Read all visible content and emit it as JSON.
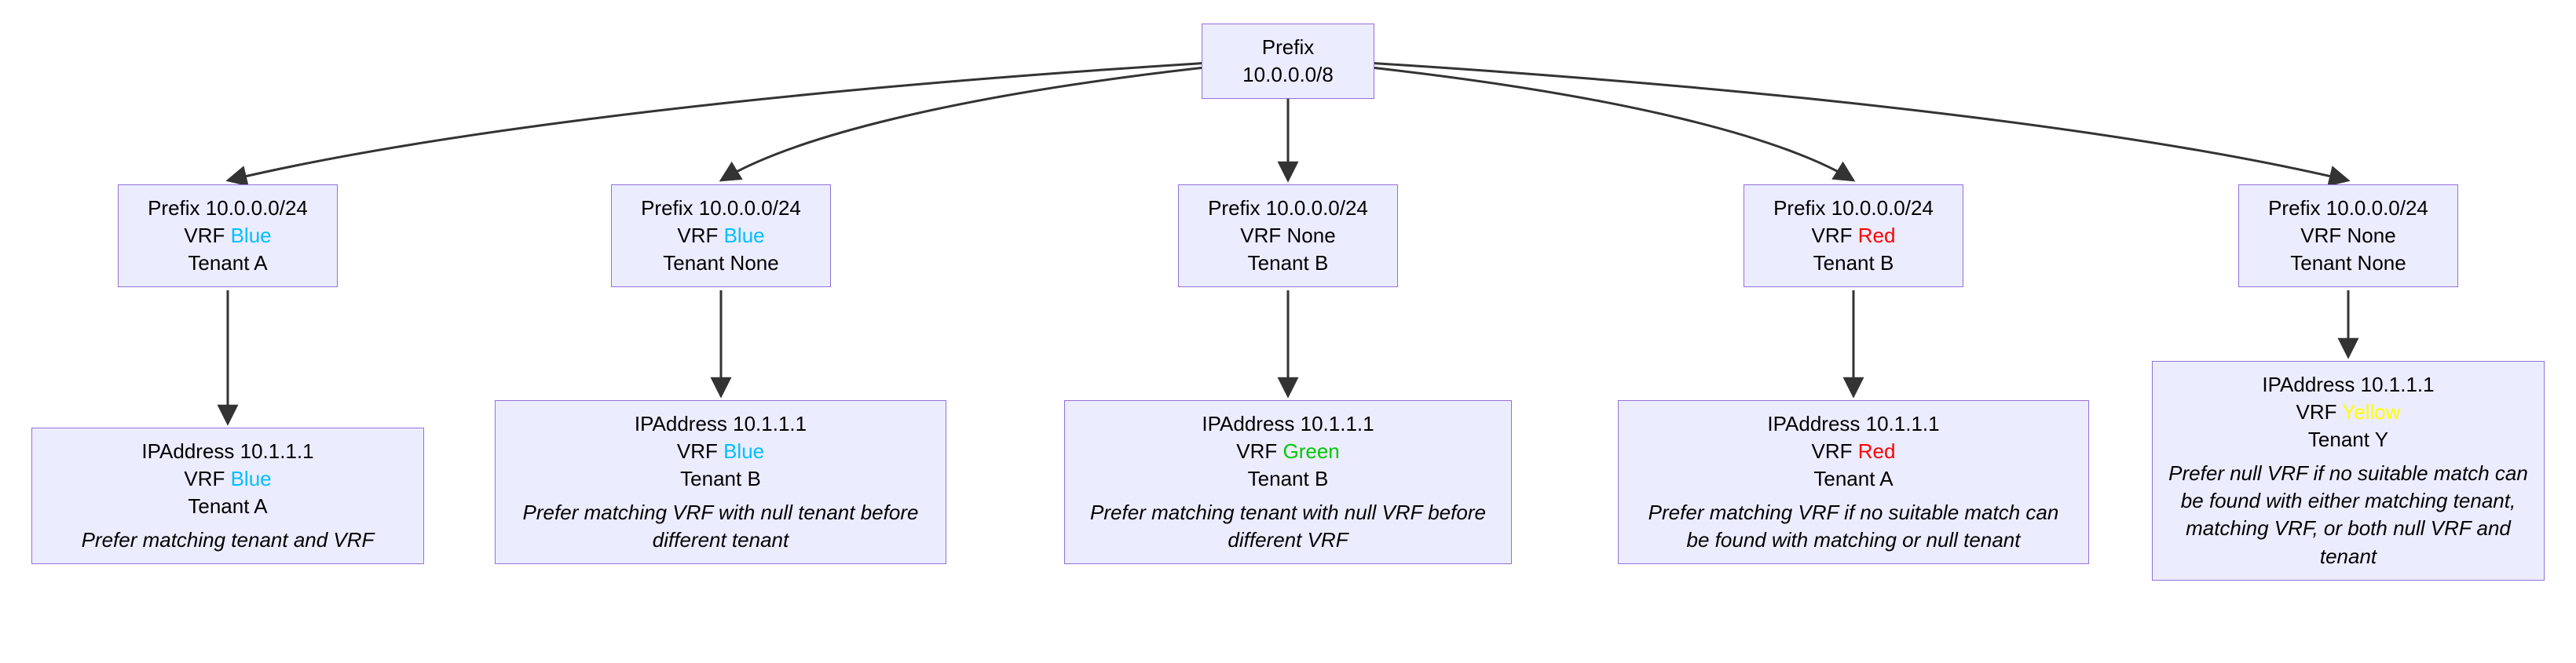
{
  "root": {
    "label": "Prefix 10.0.0.0/8"
  },
  "branches": [
    {
      "prefix": {
        "label_prefix": "Prefix 10.0.0.0/24",
        "vrf_label": "VRF ",
        "vrf_name": "Blue",
        "vrf_class": "vrf-blue",
        "tenant": "Tenant A"
      },
      "ip": {
        "label_ip": "IPAddress 10.1.1.1",
        "vrf_label": "VRF ",
        "vrf_name": "Blue",
        "vrf_class": "vrf-blue",
        "tenant": "Tenant A",
        "rule": "Prefer matching tenant and VRF"
      }
    },
    {
      "prefix": {
        "label_prefix": "Prefix 10.0.0.0/24",
        "vrf_label": "VRF ",
        "vrf_name": "Blue",
        "vrf_class": "vrf-blue",
        "tenant": "Tenant None"
      },
      "ip": {
        "label_ip": "IPAddress 10.1.1.1",
        "vrf_label": "VRF ",
        "vrf_name": "Blue",
        "vrf_class": "vrf-blue",
        "tenant": "Tenant B",
        "rule": "Prefer matching VRF with null tenant before different tenant"
      }
    },
    {
      "prefix": {
        "label_prefix": "Prefix 10.0.0.0/24",
        "vrf_label": "VRF None",
        "vrf_name": "",
        "vrf_class": "",
        "tenant": "Tenant B"
      },
      "ip": {
        "label_ip": "IPAddress 10.1.1.1",
        "vrf_label": "VRF ",
        "vrf_name": "Green",
        "vrf_class": "vrf-green",
        "tenant": "Tenant B",
        "rule": "Prefer matching tenant with null VRF before different VRF"
      }
    },
    {
      "prefix": {
        "label_prefix": "Prefix 10.0.0.0/24",
        "vrf_label": "VRF ",
        "vrf_name": "Red",
        "vrf_class": "vrf-red",
        "tenant": "Tenant B"
      },
      "ip": {
        "label_ip": "IPAddress 10.1.1.1",
        "vrf_label": "VRF ",
        "vrf_name": "Red",
        "vrf_class": "vrf-red",
        "tenant": "Tenant A",
        "rule": "Prefer matching VRF if no suitable match can be found with matching or null tenant"
      }
    },
    {
      "prefix": {
        "label_prefix": "Prefix 10.0.0.0/24",
        "vrf_label": "VRF None",
        "vrf_name": "",
        "vrf_class": "",
        "tenant": "Tenant None"
      },
      "ip": {
        "label_ip": "IPAddress 10.1.1.1",
        "vrf_label": "VRF ",
        "vrf_name": "Yellow",
        "vrf_class": "vrf-yellow",
        "tenant": "Tenant Y",
        "rule": "Prefer null VRF if no suitable match can be found with either matching tenant, matching VRF, or both null VRF and tenant"
      }
    }
  ],
  "colors": {
    "node_fill": "#ECECFF",
    "node_border": "#9370DB",
    "edge": "#333333"
  }
}
